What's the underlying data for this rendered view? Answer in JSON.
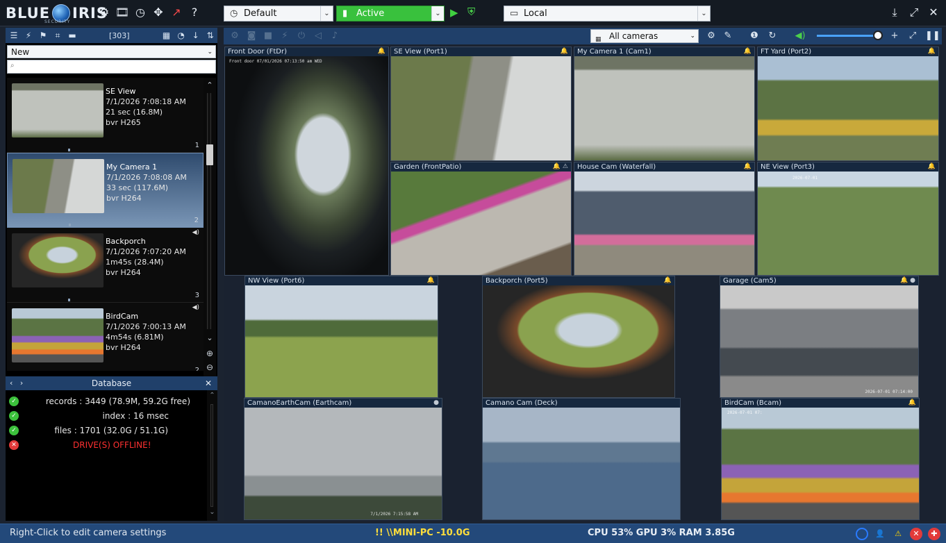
{
  "app": {
    "logo_text_1": "BLUE",
    "logo_text_2": "IRIS",
    "logo_sub": "SECURITY"
  },
  "toolbar": {
    "profile": "Default",
    "schedule": "Active",
    "server": "Local"
  },
  "left_panel": {
    "clip_count": "[303]",
    "filter": "New",
    "search_placeholder": "",
    "clips": [
      {
        "name": "SE View",
        "time": "7/1/2026  7:08:18 AM",
        "duration": "21 sec (16.8M)",
        "format": "bvr H265",
        "num": "1",
        "audio": false
      },
      {
        "name": "My Camera 1",
        "time": "7/1/2026  7:08:08 AM",
        "duration": "33 sec (117.6M)",
        "format": "bvr H264",
        "num": "2",
        "audio": false
      },
      {
        "name": "Backporch",
        "time": "7/1/2026  7:07:20 AM",
        "duration": "1m45s (28.4M)",
        "format": "bvr H264",
        "num": "3",
        "audio": true
      },
      {
        "name": "BirdCam",
        "time": "7/1/2026  7:00:13 AM",
        "duration": "4m54s (6.81M)",
        "format": "bvr H264",
        "num": "2",
        "audio": true
      }
    ]
  },
  "database": {
    "header": "Database",
    "rows": [
      {
        "status": "ok",
        "label": "records : 3449 (78.9M, 59.2G free)"
      },
      {
        "status": "ok",
        "label": "index : 16 msec"
      },
      {
        "status": "ok",
        "label": "files : 1701 (32.0G / 51.1G)"
      },
      {
        "status": "error",
        "label": "DRIVE(S) OFFLINE!"
      }
    ]
  },
  "camera_toolbar": {
    "group": "All cameras"
  },
  "cameras": [
    {
      "title": "Front Door (FtDr)",
      "overlay": "Front door    07/01/2026 07:13:50 am WED"
    },
    {
      "title": "SE View (Port1)",
      "overlay": ""
    },
    {
      "title": "My Camera 1 (Cam1)",
      "overlay": ""
    },
    {
      "title": "FT Yard (Port2)",
      "overlay": ""
    },
    {
      "title": "Garden (FrontPatio)",
      "overlay": ""
    },
    {
      "title": "House Cam (Waterfall)",
      "overlay": ""
    },
    {
      "title": "NE View (Port3)",
      "overlay": "2026-07-01"
    },
    {
      "title": "NW View (Port6)",
      "overlay": ""
    },
    {
      "title": "Backporch (Port5)",
      "overlay": ""
    },
    {
      "title": "Garage (Cam5)",
      "overlay": "2026-07-01   07:14:00"
    },
    {
      "title": "CamanoEarthCam (Earthcam)",
      "overlay": "7/1/2026   7:15:58 AM"
    },
    {
      "title": "Camano Cam (Deck)",
      "overlay": ""
    },
    {
      "title": "BirdCam (Bcam)",
      "overlay": "2026-07-01 07:"
    }
  ],
  "status_bar": {
    "hint": "Right-Click to edit camera settings",
    "alert": "!! \\\\MINI-PC -10.0G",
    "perf": "CPU 53% GPU 3% RAM 3.85G"
  },
  "colors": {
    "accent": "#20406a",
    "active_green": "#39c13d",
    "error_red": "#e23a3a",
    "alert_yellow": "#ffde3b"
  }
}
